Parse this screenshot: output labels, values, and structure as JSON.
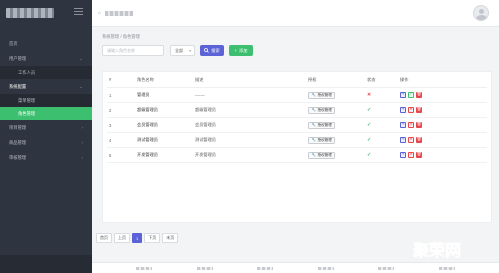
{
  "sidebar": {
    "items": [
      {
        "label": "首页",
        "type": "top"
      },
      {
        "label": "用户管理",
        "type": "top",
        "chevron": "down"
      },
      {
        "label": "工作人员",
        "type": "sub"
      },
      {
        "label": "系统配置",
        "type": "top",
        "chevron": "down",
        "open": true
      },
      {
        "label": "菜单管理",
        "type": "sub"
      },
      {
        "label": "角色管理",
        "type": "sub",
        "active": true
      },
      {
        "label": "项目管理",
        "type": "top",
        "chevron": "right"
      },
      {
        "label": "商品管理",
        "type": "top",
        "chevron": "right"
      },
      {
        "label": "审核管理",
        "type": "top",
        "chevron": "right"
      }
    ]
  },
  "breadcrumb": "系统管理 / 角色管理",
  "toolbar": {
    "search_placeholder": "请输入角色名称",
    "select_value": "全部",
    "search_label": "搜索",
    "add_label": "添加"
  },
  "table": {
    "headers": {
      "num": "#",
      "name": "角色名称",
      "desc": "描述",
      "perm": "授权",
      "status": "状态",
      "ops": "操作"
    },
    "perm_button_label": "授权管理",
    "rows": [
      {
        "num": "1",
        "name": "管理员",
        "desc": "-------",
        "status": "disabled"
      },
      {
        "num": "2",
        "name": "超级管理员",
        "desc": "超级管理员",
        "status": "enabled"
      },
      {
        "num": "3",
        "name": "会员管理员",
        "desc": "会员管理员",
        "status": "enabled"
      },
      {
        "num": "4",
        "name": "测试管理员",
        "desc": "测试管理员",
        "status": "enabled"
      },
      {
        "num": "5",
        "name": "开发管理员",
        "desc": "开发管理员",
        "status": "enabled"
      }
    ]
  },
  "pagination": {
    "first": "首页",
    "prev": "上页",
    "current": "1",
    "next": "下页",
    "last": "末页"
  },
  "watermark": "聚荣网",
  "colors": {
    "sidebar": "#2e3440",
    "accent_green": "#3cbf6e",
    "accent_blue": "#5b63d6",
    "danger": "#e5484d"
  }
}
